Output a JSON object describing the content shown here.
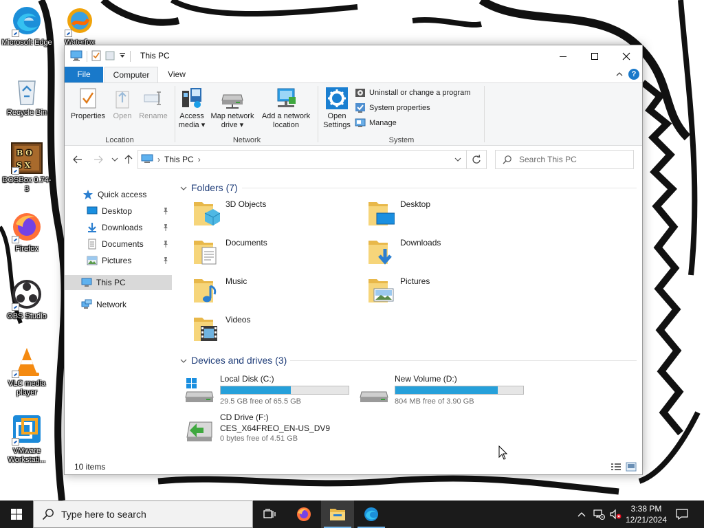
{
  "desktop": {
    "icons": [
      {
        "label": "Microsoft Edge",
        "icon": "edge-icon"
      },
      {
        "label": "Recycle Bin",
        "icon": "recycle-bin-icon"
      },
      {
        "label": "DOSBox 0.74-3",
        "icon": "dosbox-icon"
      },
      {
        "label": "Firefox",
        "icon": "firefox-icon"
      },
      {
        "label": "OBS Studio",
        "icon": "obs-icon"
      },
      {
        "label": "VLC media player",
        "icon": "vlc-icon"
      },
      {
        "label": "VMware Workstati...",
        "icon": "vmware-icon"
      },
      {
        "label": "Waterfox",
        "icon": "waterfox-icon"
      }
    ]
  },
  "window": {
    "title": "This PC",
    "tabs": {
      "file": "File",
      "computer": "Computer",
      "view": "View"
    },
    "ribbon": {
      "location": {
        "label": "Location",
        "properties": "Properties",
        "open": "Open",
        "rename": "Rename"
      },
      "network": {
        "label": "Network",
        "access_media_1": "Access",
        "access_media_2": "media",
        "map_drive_1": "Map network",
        "map_drive_2": "drive",
        "add_location_1": "Add a network",
        "add_location_2": "location"
      },
      "system": {
        "label": "System",
        "open_settings_1": "Open",
        "open_settings_2": "Settings",
        "uninstall": "Uninstall or change a program",
        "system_properties": "System properties",
        "manage": "Manage"
      }
    },
    "address": {
      "path": "This PC"
    },
    "search": {
      "placeholder": "Search This PC"
    },
    "nav": {
      "quick_access": "Quick access",
      "desktop": "Desktop",
      "downloads": "Downloads",
      "documents": "Documents",
      "pictures": "Pictures",
      "this_pc": "This PC",
      "network": "Network"
    },
    "folders": {
      "heading": "Folders (7)",
      "items": [
        "3D Objects",
        "Desktop",
        "Documents",
        "Downloads",
        "Music",
        "Pictures",
        "Videos"
      ]
    },
    "drives": {
      "heading": "Devices and drives (3)",
      "c": {
        "name": "Local Disk (C:)",
        "free": "29.5 GB free of 65.5 GB",
        "used_fraction": 0.55
      },
      "d": {
        "name": "New Volume (D:)",
        "free": "804 MB free of 3.90 GB",
        "used_fraction": 0.8
      },
      "f": {
        "name": "CD Drive (F:)",
        "label": "CES_X64FREO_EN-US_DV9",
        "free": "0 bytes free of 4.51 GB"
      }
    },
    "status": {
      "count": "10 items"
    }
  },
  "taskbar": {
    "search_placeholder": "Type here to search",
    "time": "3:38 PM",
    "date": "12/21/2024"
  },
  "colors": {
    "accent": "#1979ca",
    "drive_bar": "#26a0da",
    "taskbar": "#1b1b1b",
    "selection": "#d9d9d9"
  }
}
